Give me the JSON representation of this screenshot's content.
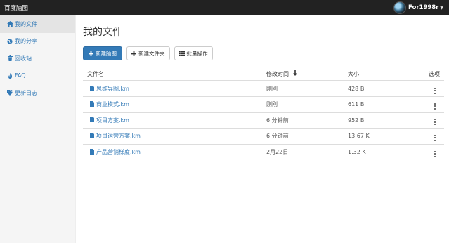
{
  "topbar": {
    "brand": "百度脑图",
    "username": "For1998r"
  },
  "sidebar": {
    "items": [
      {
        "label": "我的文件",
        "icon": "home-icon",
        "active": true
      },
      {
        "label": "我的分享",
        "icon": "globe-icon",
        "active": false
      },
      {
        "label": "回收站",
        "icon": "trash-icon",
        "active": false
      },
      {
        "label": "FAQ",
        "icon": "fire-icon",
        "active": false
      },
      {
        "label": "更新日志",
        "icon": "tags-icon",
        "active": false
      }
    ]
  },
  "main": {
    "title": "我的文件",
    "buttons": {
      "new_map": "新建脑图",
      "new_folder": "新建文件夹",
      "batch": "批量操作"
    },
    "table": {
      "headers": {
        "name": "文件名",
        "modified": "修改时间",
        "size": "大小",
        "options": "选项"
      },
      "rows": [
        {
          "name": "思维导图.km",
          "modified": "刚刚",
          "size": "428 B"
        },
        {
          "name": "商业模式.km",
          "modified": "刚刚",
          "size": "611 B"
        },
        {
          "name": "项目方案.km",
          "modified": "6 分钟前",
          "size": "952 B"
        },
        {
          "name": "项目运营方案.km",
          "modified": "6 分钟前",
          "size": "13.67 K"
        },
        {
          "name": "产品营销梯度.km",
          "modified": "2月22日",
          "size": "1.32 K"
        }
      ]
    }
  },
  "colors": {
    "topbar": "#222222",
    "link": "#337ab7",
    "primary": "#337ab7",
    "sidebar": "#f5f5f5"
  }
}
